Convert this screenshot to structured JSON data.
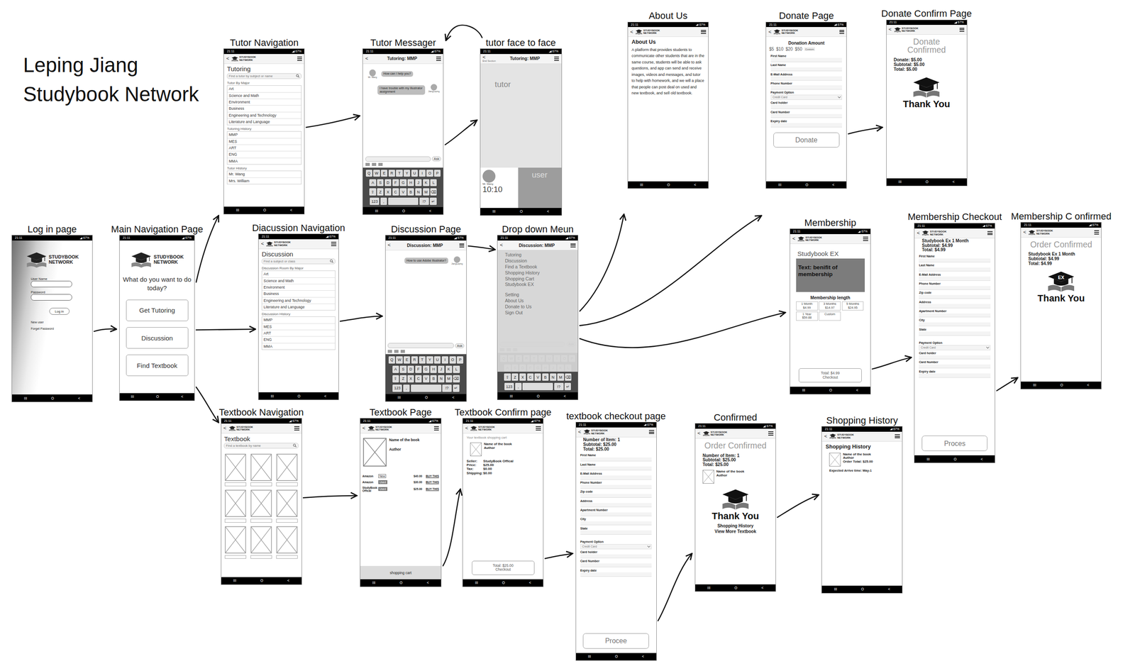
{
  "author": "Leping Jiang",
  "project": "Studybook Network",
  "status_bar": {
    "time": "21:11",
    "battery": "67%"
  },
  "nav_bar": [
    "III",
    "O",
    "<"
  ],
  "logo": [
    "STUDYBOOK",
    "NETWORK"
  ],
  "back": "<",
  "keyboard": [
    [
      "Q",
      "W",
      "E",
      "R",
      "T",
      "Y",
      "U",
      "I",
      "O",
      "P"
    ],
    [
      "A",
      "S",
      "D",
      "F",
      "G",
      "H",
      "J",
      "K",
      "L"
    ],
    [
      "⇧",
      "Z",
      "X",
      "C",
      "V",
      "B",
      "N",
      "M",
      "⌫"
    ],
    [
      "123",
      ",",
      "",
      "!?",
      "↵"
    ]
  ],
  "screens": [
    {
      "title": "Log in page",
      "kind": "login",
      "blocks": [
        {
          "kind": "logo-big"
        },
        {
          "kind": "login-field",
          "label": "User Name"
        },
        {
          "kind": "login-field",
          "label": "Password"
        },
        {
          "kind": "pill",
          "label": "Log in"
        },
        {
          "kind": "small",
          "text": "New user"
        },
        {
          "kind": "small",
          "text": "Forget Password"
        }
      ]
    },
    {
      "title": "Main Navigation Page",
      "kind": "plain",
      "blocks": [
        {
          "kind": "logo-big"
        },
        {
          "kind": "prompt",
          "text": "What do you want to do today?"
        },
        {
          "kind": "nav-button",
          "label": "Get Tutoring"
        },
        {
          "kind": "nav-button",
          "label": "Discussion"
        },
        {
          "kind": "nav-button",
          "label": "Find Textbook"
        }
      ]
    },
    {
      "title": "Tutor Navigation",
      "kind": "plain",
      "blocks": [
        {
          "kind": "appbar"
        },
        {
          "kind": "heading",
          "text": "Tutoring"
        },
        {
          "kind": "search",
          "placeholder": "Find a tutor by subject or name"
        },
        {
          "kind": "section",
          "text": "Tutor By Major"
        },
        {
          "kind": "list",
          "items": [
            "Art",
            "Science and Math",
            "Environment",
            "Business",
            "Engineering and Technology",
            "Literature and Language"
          ]
        },
        {
          "kind": "section",
          "text": "Tutoring History"
        },
        {
          "kind": "list",
          "items": [
            "MMP",
            "MES",
            "ART",
            "ENG",
            "MMA"
          ]
        },
        {
          "kind": "section",
          "text": "Tutor History"
        },
        {
          "kind": "list",
          "items": [
            "Mr. Wang",
            "Mrs. William"
          ]
        }
      ]
    },
    {
      "title": "Tutor Messager",
      "kind": "plain",
      "blocks": [
        {
          "kind": "appbar",
          "title": "Tutoring: MMP"
        },
        {
          "kind": "chat",
          "messages": [
            {
              "text": "How can I help you?",
              "side": "left",
              "name": "Mr. Wang"
            },
            {
              "text": "I have trouble with my Illustrator assignment",
              "side": "right",
              "name": "JiangLeping"
            }
          ]
        },
        {
          "kind": "spacer"
        },
        {
          "kind": "compose",
          "button": "Ask"
        },
        {
          "kind": "keyboard"
        }
      ]
    },
    {
      "title": "tutor face to face",
      "kind": "plain",
      "blocks": [
        {
          "kind": "appbar",
          "title": "Tutoring: MMP",
          "note": "End Section"
        },
        {
          "kind": "video",
          "label": "tutor"
        },
        {
          "kind": "call-bar",
          "name": "Mr. Wang",
          "time": "10:10",
          "self": "user"
        }
      ]
    },
    {
      "title": "Diacussion Navigation",
      "kind": "plain",
      "blocks": [
        {
          "kind": "appbar"
        },
        {
          "kind": "heading",
          "text": "Discussion"
        },
        {
          "kind": "search",
          "placeholder": "Find a subject or class"
        },
        {
          "kind": "section",
          "text": "Discussion Room By Major"
        },
        {
          "kind": "list",
          "items": [
            "Art",
            "Science and Math",
            "Environment",
            "Business",
            "Engineering and Technology",
            "Literature and Language"
          ]
        },
        {
          "kind": "section",
          "text": "Discussion History"
        },
        {
          "kind": "list",
          "items": [
            "MMP",
            "MES",
            "ART",
            "ENG",
            "MMA"
          ]
        }
      ]
    },
    {
      "title": "Discussion Page",
      "kind": "plain",
      "blocks": [
        {
          "kind": "appbar",
          "title": "Discussion: MMP"
        },
        {
          "kind": "chat",
          "messages": [
            {
              "text": "How to use Adobe Illustrator?",
              "side": "right",
              "name": "JiangLeping"
            }
          ]
        },
        {
          "kind": "spacer"
        },
        {
          "kind": "compose",
          "button": "Ask"
        },
        {
          "kind": "keyboard"
        }
      ]
    },
    {
      "title": "Drop down Meun",
      "kind": "plain",
      "blocks": [
        {
          "kind": "appbar",
          "title": "Discussion: MMP"
        },
        {
          "kind": "spacer"
        },
        {
          "kind": "compose",
          "button": "Ask"
        },
        {
          "kind": "keyboard"
        },
        {
          "kind": "menu",
          "groups": [
            [
              "Tutoring",
              "Discussion",
              "Find a Textbook",
              "Shopping History",
              "Shopping Cart",
              "Studybook EX"
            ],
            [
              "Setting",
              "About Us",
              "Donate to Us",
              "Sign Out"
            ]
          ]
        }
      ]
    },
    {
      "title": "About Us",
      "kind": "plain",
      "blocks": [
        {
          "kind": "appbar"
        },
        {
          "kind": "bold",
          "text": "About Us"
        },
        {
          "kind": "para",
          "text": "A platform that provides students to communicate other students that are in the same course, students will be able to ask questions, and app can send and receive images, videos and messages, and tutor to help with homework, and we will a place that people can post deal on used and new textbook, and sell old textbook."
        }
      ]
    },
    {
      "title": "Donate Page",
      "kind": "plain",
      "blocks": [
        {
          "kind": "appbar"
        },
        {
          "kind": "bold-center",
          "text": "Donation Amount"
        },
        {
          "kind": "amounts",
          "items": [
            "$5",
            "$10",
            "$20",
            "$50",
            "Custom"
          ]
        },
        {
          "kind": "field",
          "label": "First Name"
        },
        {
          "kind": "field",
          "label": "Last Name"
        },
        {
          "kind": "field",
          "label": "E-Mail Address"
        },
        {
          "kind": "field",
          "label": "Phone Number"
        },
        {
          "kind": "select",
          "label": "Payment Option",
          "value": "Credit Card"
        },
        {
          "kind": "field",
          "label": "Card holder"
        },
        {
          "kind": "field",
          "label": "Card Number"
        },
        {
          "kind": "field",
          "label": "Expiry date"
        },
        {
          "kind": "big-button",
          "label": "Donate"
        }
      ]
    },
    {
      "title": "Donate Confirm Page",
      "kind": "plain",
      "blocks": [
        {
          "kind": "appbar"
        },
        {
          "kind": "big-confirm",
          "text": "Donate Confirmed"
        },
        {
          "kind": "lines",
          "items": [
            "Donate: $5.00",
            "Subtotal: $5.00",
            "Total: $5.00"
          ]
        },
        {
          "kind": "grad-icon",
          "badge": ""
        },
        {
          "kind": "thanks",
          "text": "Thank You"
        }
      ]
    },
    {
      "title": "Membership",
      "kind": "plain",
      "blocks": [
        {
          "kind": "appbar"
        },
        {
          "kind": "grey-title",
          "text": "Studybook EX"
        },
        {
          "kind": "dark-box",
          "text": "Text: benifit of membership"
        },
        {
          "kind": "bold-center",
          "text": "Membership length"
        },
        {
          "kind": "plans",
          "items": [
            {
              "name": "1 Month",
              "price": "$4.99"
            },
            {
              "name": "3 Months",
              "price": "$14.97"
            },
            {
              "name": "5 Months",
              "price": "$24.95"
            },
            {
              "name": "1 Year",
              "price": "$59.88"
            },
            {
              "name": "Custom",
              "price": ""
            }
          ]
        },
        {
          "kind": "spacer"
        },
        {
          "kind": "checkout-button",
          "lines": [
            "Total: $4.99",
            "Checkout"
          ]
        },
        {
          "kind": "gap"
        }
      ]
    },
    {
      "title": "Membership Checkout",
      "kind": "plain",
      "blocks": [
        {
          "kind": "appbar"
        },
        {
          "kind": "lines",
          "items": [
            "Studybook Ex 1 Month",
            "Subtotal: $4.99",
            "Total: $4.99"
          ]
        },
        {
          "kind": "field",
          "label": "First Name"
        },
        {
          "kind": "field",
          "label": "Last Name"
        },
        {
          "kind": "field",
          "label": "E-Mail Address"
        },
        {
          "kind": "field",
          "label": "Phone Number"
        },
        {
          "kind": "field",
          "label": "Zip code"
        },
        {
          "kind": "field",
          "label": "Address"
        },
        {
          "kind": "field",
          "label": "Apartment Number"
        },
        {
          "kind": "field",
          "label": "City"
        },
        {
          "kind": "field",
          "label": "State"
        },
        {
          "kind": "gap"
        },
        {
          "kind": "select",
          "label": "Payment Option",
          "value": "Credit Card"
        },
        {
          "kind": "field",
          "label": "Card holder"
        },
        {
          "kind": "field",
          "label": "Card Number"
        },
        {
          "kind": "field",
          "label": "Expiry date"
        },
        {
          "kind": "spacer"
        },
        {
          "kind": "big-button",
          "label": "Proces"
        },
        {
          "kind": "gap"
        }
      ]
    },
    {
      "title": "Membership C onfirmed",
      "kind": "plain",
      "blocks": [
        {
          "kind": "appbar"
        },
        {
          "kind": "big-confirm",
          "text": "Order Confirmed"
        },
        {
          "kind": "lines",
          "items": [
            "Studybook Ex 1 Month",
            "Subtotal: $4.99",
            "Total: $4.99"
          ]
        },
        {
          "kind": "grad-icon",
          "badge": "EX"
        },
        {
          "kind": "thanks",
          "text": "Thank You"
        }
      ]
    },
    {
      "title": "Textbook Navigation",
      "kind": "plain",
      "blocks": [
        {
          "kind": "appbar"
        },
        {
          "kind": "heading",
          "text": "Textbook"
        },
        {
          "kind": "search",
          "placeholder": "Find a textbook by name"
        },
        {
          "kind": "book-grid",
          "cells": 9
        }
      ]
    },
    {
      "title": "Textbook Page",
      "kind": "plain",
      "blocks": [
        {
          "kind": "appbar"
        },
        {
          "kind": "product",
          "name": "Name of the book",
          "author": "Author"
        },
        {
          "kind": "offers",
          "items": [
            {
              "seller": "Amazon",
              "condition": "New",
              "price": "$40.00",
              "action": "BUY THIS"
            },
            {
              "seller": "Amazon",
              "condition": "Used",
              "price": "$30.00",
              "action": "BUY THIS"
            },
            {
              "seller": "StudyBook Offical",
              "condition": "Used",
              "price": "$25.00",
              "action": "BUY THIS"
            }
          ]
        },
        {
          "kind": "spacer"
        },
        {
          "kind": "cart-bar",
          "text": "shopping cart"
        }
      ]
    },
    {
      "title": "Textbook Confirm page",
      "kind": "plain",
      "blocks": [
        {
          "kind": "appbar"
        },
        {
          "kind": "note",
          "text": "Your textbook shopping cart"
        },
        {
          "kind": "item",
          "lines": [
            "Name of the book",
            "Author"
          ]
        },
        {
          "kind": "kv",
          "items": [
            {
              "k": "Seller:",
              "v": "StudyBook Offical"
            },
            {
              "k": "Price:",
              "v": "$25.00"
            },
            {
              "k": "Tax:",
              "v": "$0.00"
            },
            {
              "k": "Shipping:",
              "v": "$0.00"
            }
          ]
        },
        {
          "kind": "spacer"
        },
        {
          "kind": "checkout-button",
          "lines": [
            "Total: $25.00",
            "Checkout"
          ]
        },
        {
          "kind": "gap"
        }
      ]
    },
    {
      "title": "textbook checkout page",
      "kind": "plain",
      "blocks": [
        {
          "kind": "appbar"
        },
        {
          "kind": "lines",
          "items": [
            "Number of Item: 1",
            "Subtotal: $25.00",
            "Total: $25.00"
          ]
        },
        {
          "kind": "field",
          "label": "First Name"
        },
        {
          "kind": "field",
          "label": "Last Name"
        },
        {
          "kind": "field",
          "label": "E-Mail Address"
        },
        {
          "kind": "field",
          "label": "Phone Number"
        },
        {
          "kind": "field",
          "label": "Zip code"
        },
        {
          "kind": "field",
          "label": "Address"
        },
        {
          "kind": "field",
          "label": "Apartment Number"
        },
        {
          "kind": "field",
          "label": "City"
        },
        {
          "kind": "field",
          "label": "State"
        },
        {
          "kind": "gap"
        },
        {
          "kind": "select",
          "label": "Payment Option",
          "value": "Credit Card"
        },
        {
          "kind": "field",
          "label": "Card holder"
        },
        {
          "kind": "field",
          "label": "Card Number"
        },
        {
          "kind": "field",
          "label": "Expiry date"
        },
        {
          "kind": "spacer"
        },
        {
          "kind": "big-button",
          "label": "Procee"
        },
        {
          "kind": "gap"
        }
      ]
    },
    {
      "title": "Confirmed",
      "kind": "plain",
      "blocks": [
        {
          "kind": "appbar"
        },
        {
          "kind": "big-confirm",
          "text": "Order Confirmed"
        },
        {
          "kind": "lines",
          "items": [
            "Number of Item: 1",
            "Subtotal: $25.00",
            "Total: $25.00"
          ]
        },
        {
          "kind": "item",
          "lines": [
            "Name of the book",
            "Author"
          ]
        },
        {
          "kind": "grad-icon",
          "badge": ""
        },
        {
          "kind": "thanks",
          "text": "Thank You"
        },
        {
          "kind": "links",
          "items": [
            "Shopping History",
            "View More Textbook"
          ]
        }
      ]
    },
    {
      "title": "Shopping History",
      "kind": "plain",
      "blocks": [
        {
          "kind": "appbar"
        },
        {
          "kind": "bold",
          "text": "Shopping History"
        },
        {
          "kind": "item",
          "lines": [
            "Name of the book",
            "Author",
            "Order Total: $25.00"
          ]
        },
        {
          "kind": "small-bold",
          "text": "Expected Arrive time: May-1"
        }
      ]
    }
  ],
  "arrows": [
    {
      "from": "Log in page",
      "to": "Main Navigation Page"
    },
    {
      "from": "Main Navigation Page",
      "to": "Tutor Navigation"
    },
    {
      "from": "Main Navigation Page",
      "to": "Diacussion Navigation"
    },
    {
      "from": "Main Navigation Page",
      "to": "Textbook Navigation"
    },
    {
      "from": "Tutor Navigation",
      "to": "Tutor Messager"
    },
    {
      "from": "Tutor Messager",
      "to": "tutor face to face"
    },
    {
      "from": "tutor face to face",
      "to": "Tutor Messager"
    },
    {
      "from": "Diacussion Navigation",
      "to": "Discussion Page"
    },
    {
      "from": "Discussion Page",
      "to": "Drop down Meun"
    },
    {
      "from": "Drop down Meun",
      "to": "About Us"
    },
    {
      "from": "Drop down Meun",
      "to": "Donate Page"
    },
    {
      "from": "Drop down Meun",
      "to": "Membership"
    },
    {
      "from": "Donate Page",
      "to": "Donate Confirm Page"
    },
    {
      "from": "Membership",
      "to": "Membership Checkout"
    },
    {
      "from": "Membership Checkout",
      "to": "Membership C onfirmed"
    },
    {
      "from": "Textbook Navigation",
      "to": "Textbook Page"
    },
    {
      "from": "Textbook Page",
      "to": "Textbook Confirm page"
    },
    {
      "from": "Textbook Confirm page",
      "to": "textbook checkout page"
    },
    {
      "from": "textbook checkout page",
      "to": "Confirmed"
    },
    {
      "from": "Confirmed",
      "to": "Shopping History"
    }
  ]
}
